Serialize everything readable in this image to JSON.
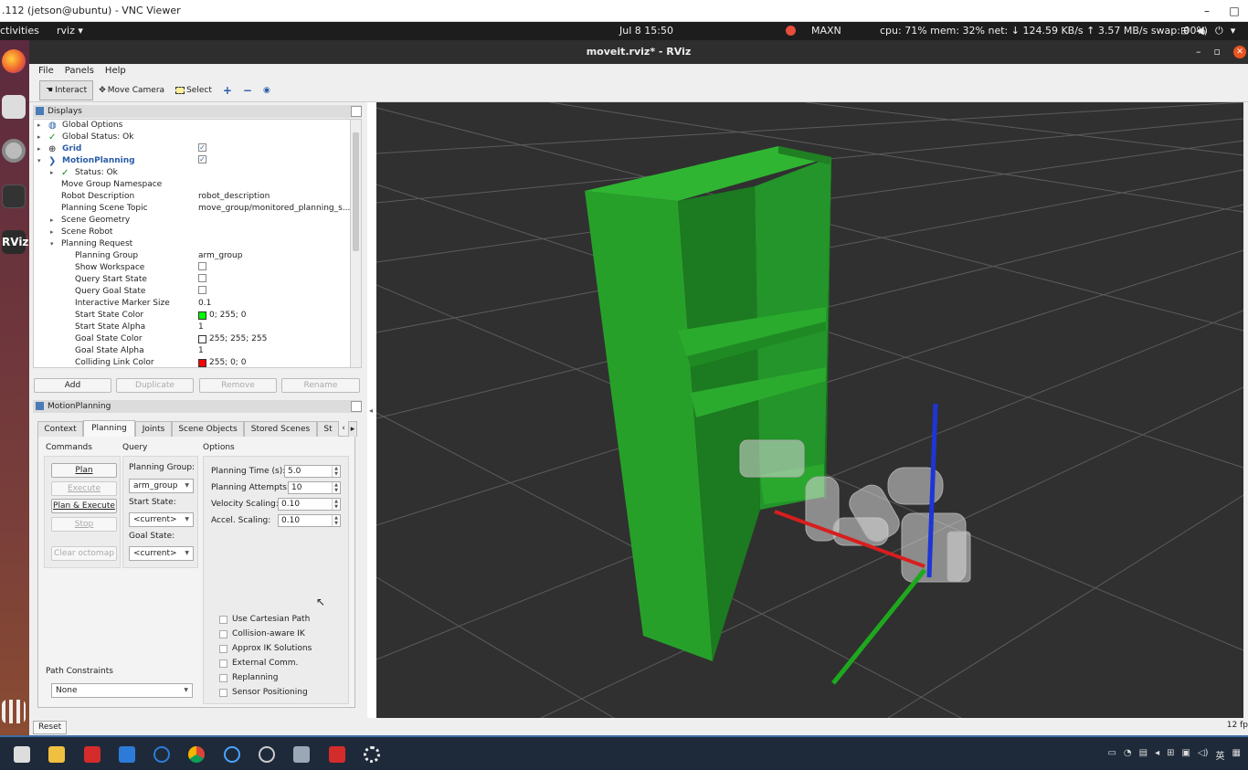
{
  "vnc": {
    "title": ".112 (jetson@ubuntu) - VNC Viewer",
    "minimize": "–",
    "maximize": "□"
  },
  "gnome": {
    "activities": "ctivities",
    "app": "rviz ▾",
    "clock": "Jul 8  15:50",
    "maxn": "MAXN",
    "stats": "cpu: 71% mem: 32% net: ↓ 124.59 KB/s ↑    3.57 MB/s swap: 00%"
  },
  "window": {
    "title": "moveit.rviz* - RViz",
    "minimize": "–",
    "restore": "▫",
    "close": "✕"
  },
  "menu": {
    "file": "File",
    "panels": "Panels",
    "help": "Help"
  },
  "toolbar": {
    "interact": "Interact",
    "move_camera": "Move Camera",
    "select": "Select",
    "plus": "+",
    "minus": "−",
    "eye": "◉"
  },
  "displays": {
    "title": "Displays",
    "rows": [
      {
        "name": "Global Options",
        "value": ""
      },
      {
        "name": "Global Status: Ok",
        "value": ""
      },
      {
        "name": "Grid",
        "value": "✓"
      },
      {
        "name": "MotionPlanning",
        "value": "✓"
      },
      {
        "name": "Status: Ok",
        "value": ""
      },
      {
        "name": "Move Group Namespace",
        "value": ""
      },
      {
        "name": "Robot Description",
        "value": "robot_description"
      },
      {
        "name": "Planning Scene Topic",
        "value": "move_group/monitored_planning_s..."
      },
      {
        "name": "Scene Geometry",
        "value": ""
      },
      {
        "name": "Scene Robot",
        "value": ""
      },
      {
        "name": "Planning Request",
        "value": ""
      },
      {
        "name": "Planning Group",
        "value": "arm_group"
      },
      {
        "name": "Show Workspace",
        "value": ""
      },
      {
        "name": "Query Start State",
        "value": ""
      },
      {
        "name": "Query Goal State",
        "value": ""
      },
      {
        "name": "Interactive Marker Size",
        "value": "0.1"
      },
      {
        "name": "Start State Color",
        "value": "0; 255; 0"
      },
      {
        "name": "Start State Alpha",
        "value": "1"
      },
      {
        "name": "Goal State Color",
        "value": "255; 255; 255"
      },
      {
        "name": "Goal State Alpha",
        "value": "1"
      },
      {
        "name": "Colliding Link Color",
        "value": "255; 0; 0"
      }
    ],
    "colors": {
      "start": "#00ff00",
      "goal": "#ffffff",
      "colliding": "#ff0000"
    },
    "buttons": {
      "add": "Add",
      "duplicate": "Duplicate",
      "remove": "Remove",
      "rename": "Rename"
    }
  },
  "motion": {
    "title": "MotionPlanning",
    "tabs": [
      "Context",
      "Planning",
      "Joints",
      "Scene Objects",
      "Stored Scenes",
      "St"
    ],
    "tab_arrows": {
      "left": "‹",
      "right": "▸"
    },
    "commands_label": "Commands",
    "query_label": "Query",
    "options_label": "Options",
    "plan": "Plan",
    "execute": "Execute",
    "plan_execute": "Plan & Execute",
    "stop": "Stop",
    "clear_octomap": "Clear octomap",
    "planning_group_label": "Planning Group:",
    "planning_group": "arm_group",
    "start_state_label": "Start State:",
    "start_state": "<current>",
    "goal_state_label": "Goal State:",
    "goal_state": "<current>",
    "planning_time_label": "Planning Time (s):",
    "planning_time": "5.0",
    "planning_attempts_label": "Planning Attempts:",
    "planning_attempts": "10",
    "velocity_label": "Velocity Scaling:",
    "velocity": "0.10",
    "accel_label": "Accel. Scaling:",
    "accel": "0.10",
    "checkboxes": [
      "Use Cartesian Path",
      "Collision-aware IK",
      "Approx IK Solutions",
      "External Comm.",
      "Replanning",
      "Sensor Positioning"
    ],
    "path_constraints_label": "Path Constraints",
    "path_constraints": "None"
  },
  "status": {
    "reset": "Reset",
    "fps": "12 fp"
  }
}
